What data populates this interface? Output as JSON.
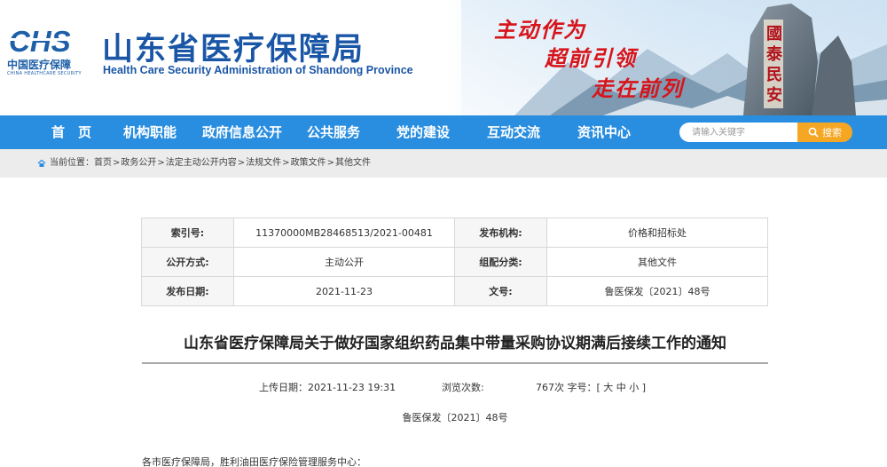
{
  "header": {
    "logo_mark": "CHS",
    "logo_cn": "中国医疗保障",
    "logo_en": "CHINA HEALTHCARE SECURITY",
    "site_title": "山东省医疗保障局",
    "site_subtitle": "Health Care Security Administration of Shandong Province",
    "slogan": [
      "主动作为",
      "超前引领",
      "走在前列"
    ],
    "stone_text": "國泰民安"
  },
  "nav": {
    "items": [
      "首　页",
      "机构职能",
      "政府信息公开",
      "公共服务",
      "党的建设",
      "互动交流",
      "资讯中心"
    ],
    "search_placeholder": "请输入关键字",
    "search_button": "搜索",
    "bg_color": "#2a8ee0",
    "button_color": "#f5a623"
  },
  "breadcrumb": {
    "prefix": "当前位置：",
    "items": [
      "首页",
      "政务公开",
      "法定主动公开内容",
      "法规文件",
      "政策文件",
      "其他文件"
    ],
    "separator": ">"
  },
  "info": {
    "index_label": "索引号:",
    "index_value": "11370000MB28468513/2021-00481",
    "issuer_label": "发布机构:",
    "issuer_value": "价格和招标处",
    "open_label": "公开方式:",
    "open_value": "主动公开",
    "group_label": "组配分类:",
    "group_value": "其他文件",
    "date_label": "发布日期:",
    "date_value": "2021-11-23",
    "docno_label": "文号:",
    "docno_value": "鲁医保发〔2021〕48号"
  },
  "article": {
    "title": "山东省医疗保障局关于做好国家组织药品集中带量采购协议期满后接续工作的通知",
    "upload_label": "上传日期：",
    "upload_value": "2021-11-23 19:31",
    "views_label": "浏览次数:",
    "views_value": "767次",
    "fontsize_label": "字号：",
    "fontsize_open": "[",
    "fontsize_large": "大",
    "fontsize_medium": "中",
    "fontsize_small": "小",
    "fontsize_close": "]",
    "doc_number": "鲁医保发〔2021〕48号",
    "salutation": "各市医疗保障局，胜利油田医疗保险管理服务中心："
  }
}
